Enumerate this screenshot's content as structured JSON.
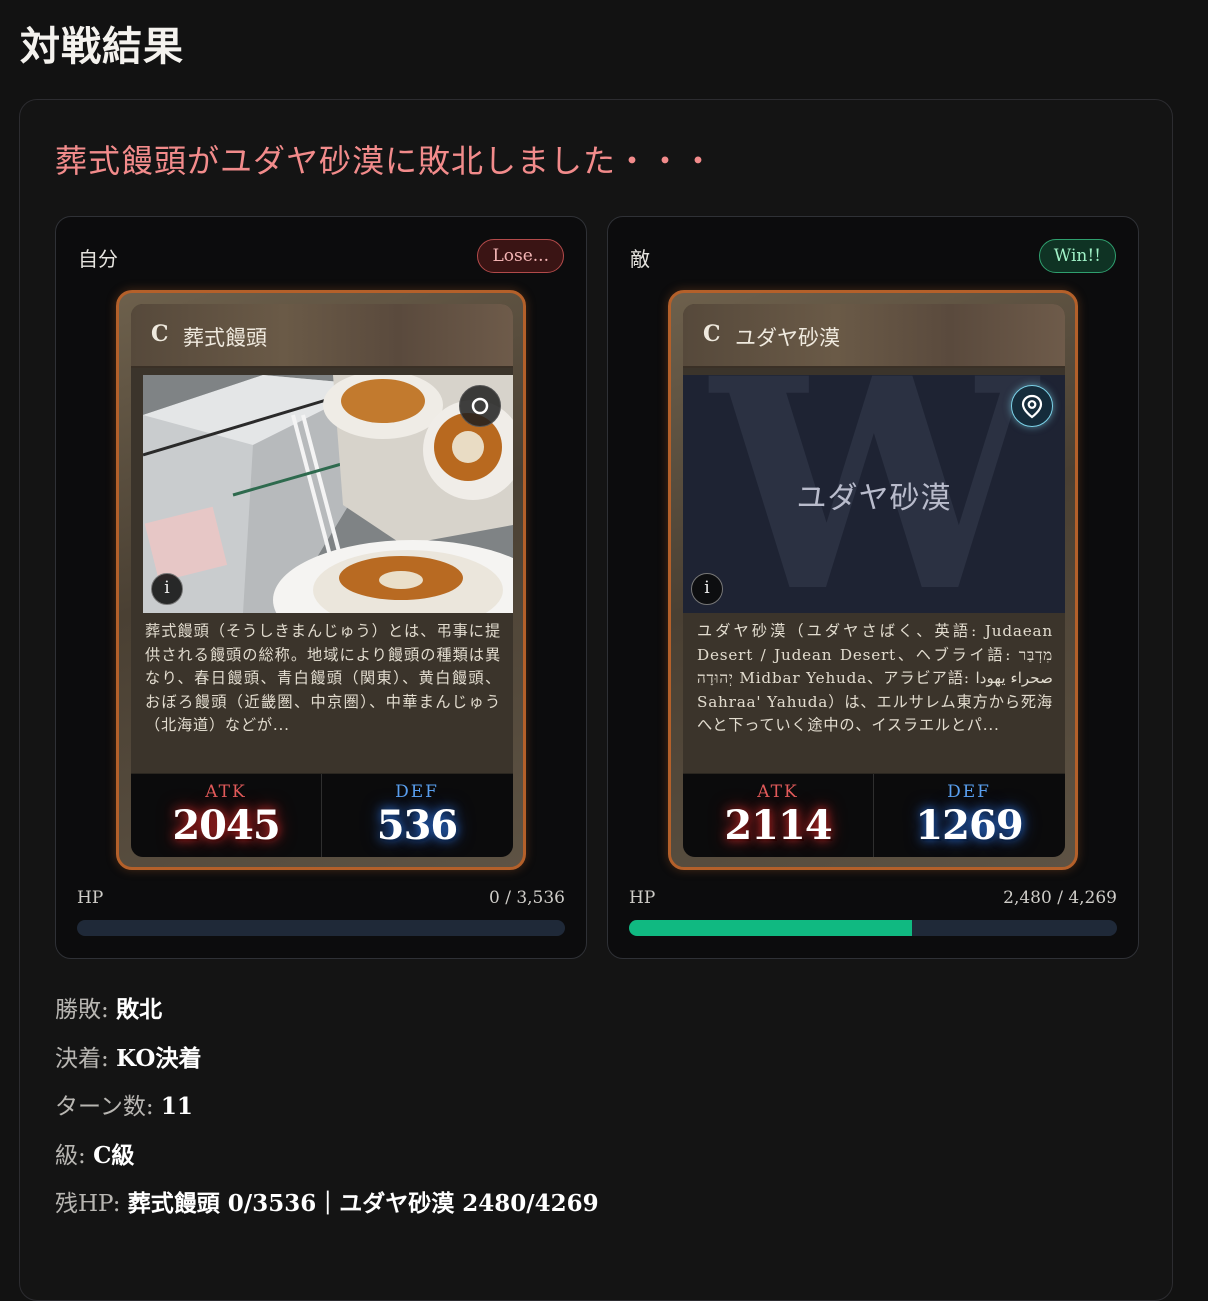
{
  "page": {
    "title": "対戦結果"
  },
  "result": {
    "headline": "葬式饅頭がユダヤ砂漠に敗北しました・・・"
  },
  "me": {
    "side_label": "自分",
    "badge": "Lose...",
    "card": {
      "rarity": "C",
      "name": "葬式饅頭",
      "description": "葬式饅頭（そうしきまんじゅう）とは、弔事に提供される饅頭の総称。地域により饅頭の種類は異なり、春日饅頭、青白饅頭（関東）、黄白饅頭、おぼろ饅頭（近畿圏、中京圏）、中華まんじゅう（北海道）などが...",
      "atk_label": "ATK",
      "atk": "2045",
      "def_label": "DEF",
      "def": "536",
      "info_label": "i"
    },
    "hp_label": "HP",
    "hp_text": "0 / 3,536",
    "hp_current": 0,
    "hp_max": 3536
  },
  "enemy": {
    "side_label": "敵",
    "badge": "Win!!",
    "card": {
      "rarity": "C",
      "name": "ユダヤ砂漠",
      "placeholder_letter": "W",
      "placeholder_name": "ユダヤ砂漠",
      "description": "ユダヤ砂漠（ユダヤさばく、英語: Judaean Desert / Judean Desert、ヘブライ語: מִדְבַּר יְהוּדָה Midbar Yehuda、アラビア語: صحراء يهودا Sahraa' Yahuda）は、エルサレム東方から死海へと下っていく途中の、イスラエルとパ...",
      "atk_label": "ATK",
      "atk": "2114",
      "def_label": "DEF",
      "def": "1269",
      "info_label": "i"
    },
    "hp_label": "HP",
    "hp_text": "2,480 / 4,269",
    "hp_current": 2480,
    "hp_max": 4269
  },
  "summary": {
    "outcome_label": "勝敗:",
    "outcome_value": "敗北",
    "decision_label": "決着:",
    "decision_value": "KO決着",
    "turns_label": "ターン数:",
    "turns_value": "11",
    "class_label": "級:",
    "class_value": "C級",
    "remaining_label": "残HP:",
    "remaining_value": "葬式饅頭 0/3536｜ユダヤ砂漠 2480/4269"
  },
  "colors": {
    "lose_text": "#f28b8b",
    "win_badge": "#2f9f6e",
    "hp_fill": "#10b981",
    "card_border": "#b4602a"
  }
}
